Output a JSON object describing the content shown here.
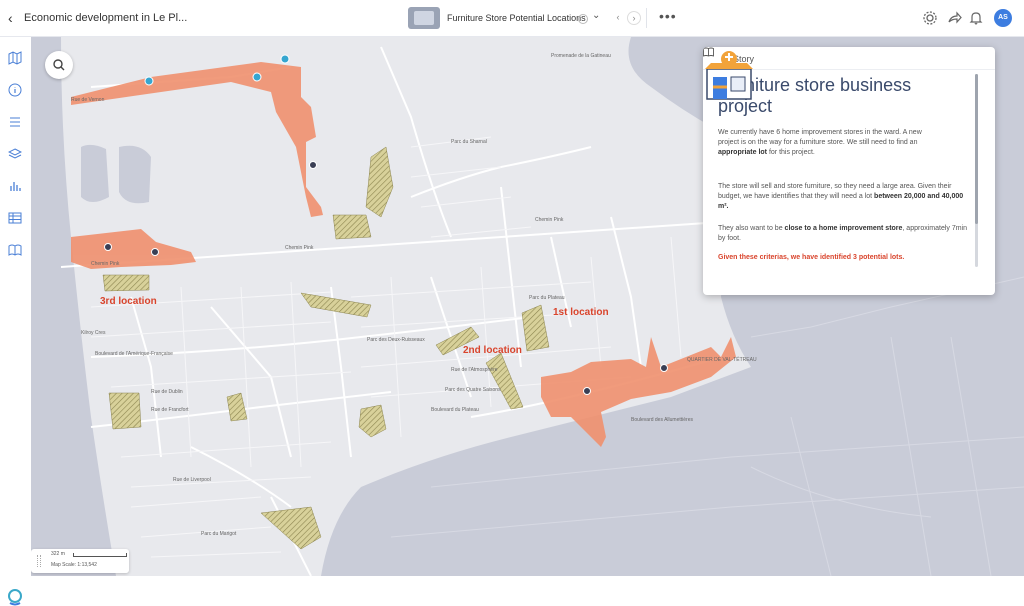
{
  "header": {
    "title": "Economic development in Le Pl...",
    "view_name": "Furniture Store Potential Locations",
    "avatar_initials": "AS"
  },
  "map": {
    "location_labels": [
      "1st location",
      "2nd location",
      "3rd location"
    ],
    "street_labels": {
      "chemin_pink_1": "Chemin Pink",
      "chemin_pink_2": "Chemin Pink",
      "chemin_pink_3": "Chemin Pink",
      "rue_vernon": "Rue de Vernon",
      "kilroy": "Kilroy Cres",
      "boul_amerique": "Boulevard de l'Amérique-Française",
      "rue_dublin": "Rue de Dublin",
      "rue_francfort": "Rue de Francfort",
      "rue_liverpool": "Rue de Liverpool",
      "rue_atmosphere": "Rue de l'Atmosphère",
      "boul_plateau": "Boulevard du Plateau",
      "boul_allumettieres": "Boulevard des Allumettières",
      "quartier": "QUARTIER DE VAL-TÉTREAU",
      "parc_plateau": "Parc du Plateau",
      "parc_quatre": "Parc des Quatre Saisons",
      "parc_marigot": "Parc du Marigot",
      "parc_deux": "Parc des Deux-Ruisseaux",
      "parc_sharnal": "Parc du Sharnal",
      "promenade": "Promenade de la Gatineau"
    },
    "scale_label": "322 m",
    "scale_text": "Map Scale: 1:13,542"
  },
  "story": {
    "header_label": "Story",
    "title": "Furniture store business project",
    "p1_a": "We currently have 6 home improvement stores in the ward. A new project is on the way for a furniture store. We still need to find an ",
    "p1_b": "appropriate lot",
    "p1_c": " for this project.",
    "p2_a": "The store will sell and store furniture, so they need a large area. Given their budget, we have identifies that they will need a lot ",
    "p2_b": "between 20,000 and 40,000 m².",
    "p3_a": "They also want to be ",
    "p3_b": "close to a home improvement store",
    "p3_c": ", approximately 7min by foot.",
    "conclusion": "Given these criterias, we have identified 3 potential lots."
  },
  "colors": {
    "accent": "#3d7de0",
    "highlight_red": "#d9442c",
    "isochrone": "#f0906e",
    "lot_hatch": "#c8c07a",
    "water": "#c9ccd8",
    "land": "#e8e9ed"
  },
  "icons": [
    "back-arrow-icon",
    "settings-icon",
    "share-icon",
    "bell-icon",
    "search-icon",
    "book-icon",
    "info-icon",
    "list-icon",
    "layers-icon",
    "chart-icon",
    "table-icon"
  ]
}
